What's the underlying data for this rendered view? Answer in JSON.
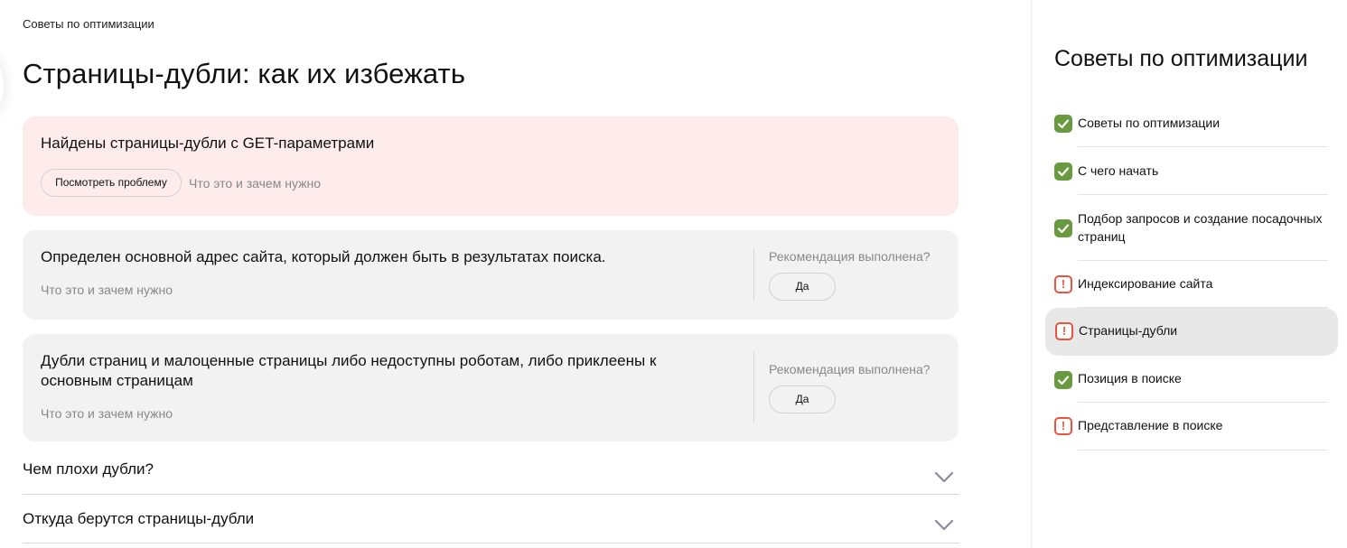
{
  "breadcrumb": "Советы по оптимизации",
  "page_title": "Страницы-дубли: как их избежать",
  "alert_card": {
    "title": "Найдены страницы-дубли с GET-параметрами",
    "button_label": "Посмотреть проблему",
    "help_link": "Что это и зачем нужно"
  },
  "recommendations": [
    {
      "text": "Определен основной адрес сайта, который должен быть в результатах поиска.",
      "help_link": "Что это и зачем нужно",
      "question": "Рекомендация выполнена?",
      "button_label": "Да"
    },
    {
      "text": "Дубли страниц и малоценные страницы либо недоступны роботам, либо приклеены к основным страницам",
      "help_link": "Что это и зачем нужно",
      "question": "Рекомендация выполнена?",
      "button_label": "Да"
    }
  ],
  "accordions": [
    {
      "title": "Чем плохи дубли?",
      "icon": "chevron-down-icon"
    },
    {
      "title": "Откуда берутся страницы-дубли",
      "icon": "chevron-down-icon"
    }
  ],
  "sidebar": {
    "title": "Советы по оптимизации",
    "items": [
      {
        "label": "Советы по оптимизации",
        "status": "ok",
        "active": false
      },
      {
        "label": "С чего начать",
        "status": "ok",
        "active": false
      },
      {
        "label": "Подбор запросов и создание посадочных страниц",
        "status": "ok",
        "active": false
      },
      {
        "label": "Индексирование сайта",
        "status": "warning",
        "active": false
      },
      {
        "label": "Страницы-дубли",
        "status": "warning",
        "active": true
      },
      {
        "label": "Позиция в поиске",
        "status": "ok",
        "active": false
      },
      {
        "label": "Представление в поиске",
        "status": "warning",
        "active": false
      }
    ]
  },
  "colors": {
    "alert_bg": "#fdeceb",
    "card_bg": "#f2f2f2",
    "ok_icon": "#6a9a3f",
    "warning_icon": "#e8553d",
    "active_nav_bg": "#e8e8e8"
  }
}
